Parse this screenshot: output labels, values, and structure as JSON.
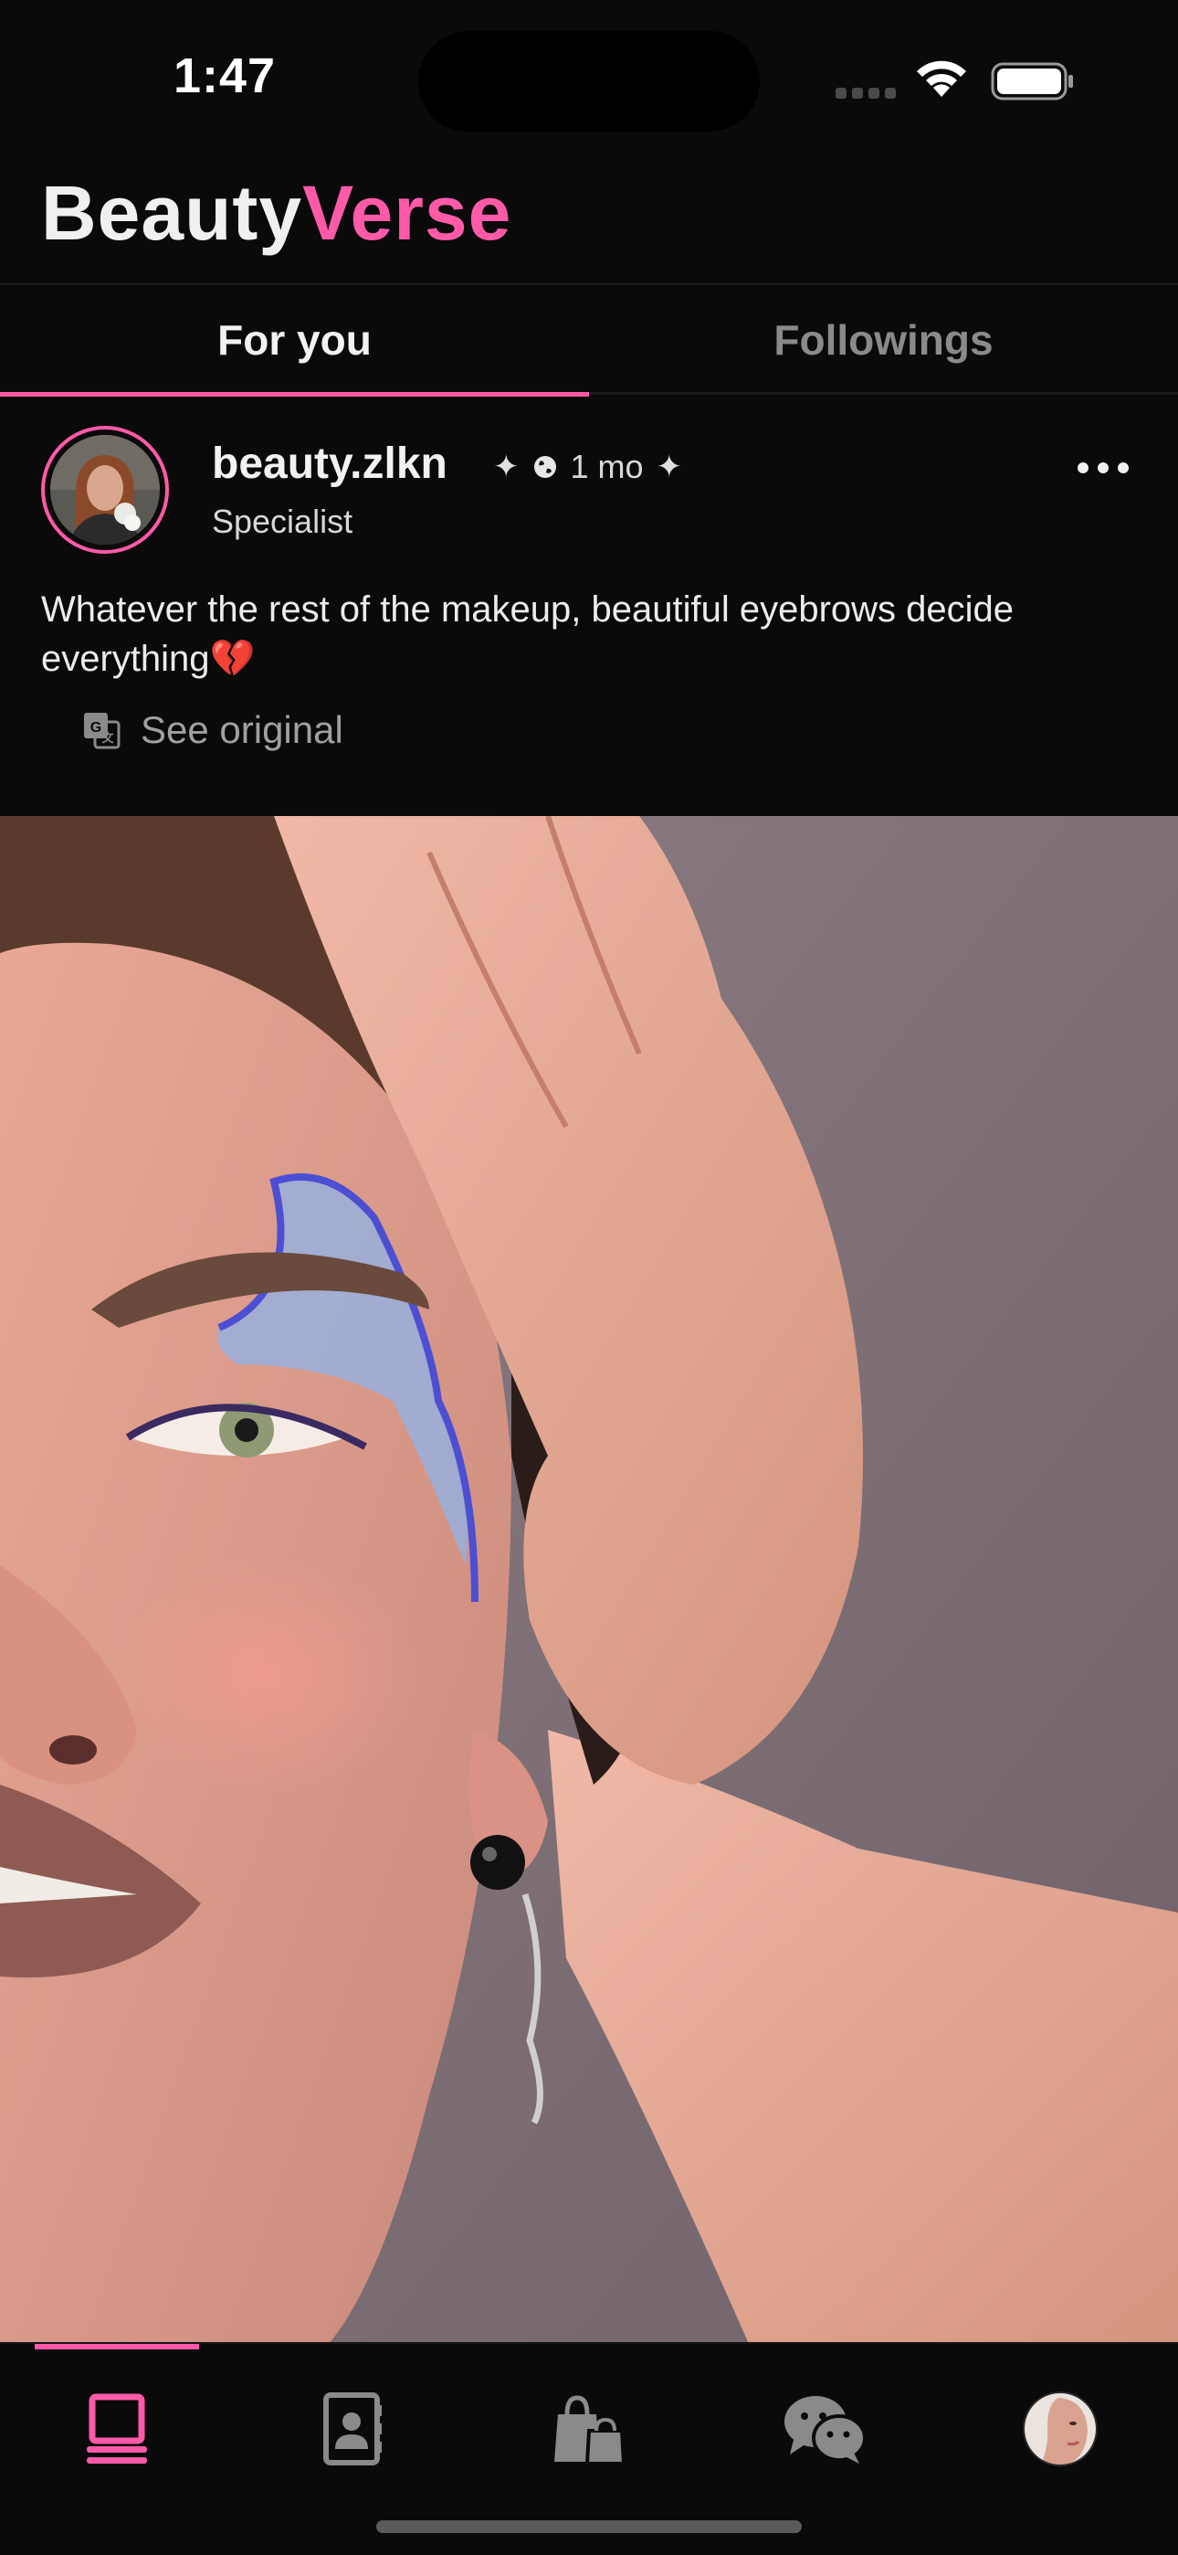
{
  "status_bar": {
    "time": "1:47"
  },
  "header": {
    "brand_part1": "Beauty",
    "brand_part2": "Verse",
    "accent_color": "#ff5aa8"
  },
  "tabs": [
    {
      "label": "For you",
      "active": true
    },
    {
      "label": "Followings",
      "active": false
    }
  ],
  "post": {
    "username": "beauty.zlkn",
    "time_ago": "1 mo",
    "role": "Specialist",
    "caption": "Whatever the rest of the makeup, beautiful eyebrows decide everything💔",
    "see_original_label": "See original"
  },
  "bottom_nav": {
    "items": [
      {
        "icon": "feed-icon",
        "active": true
      },
      {
        "icon": "contacts-book-icon",
        "active": false
      },
      {
        "icon": "shopping-bags-icon",
        "active": false
      },
      {
        "icon": "chat-bubbles-icon",
        "active": false
      },
      {
        "icon": "profile-avatar-icon",
        "active": false
      }
    ]
  }
}
